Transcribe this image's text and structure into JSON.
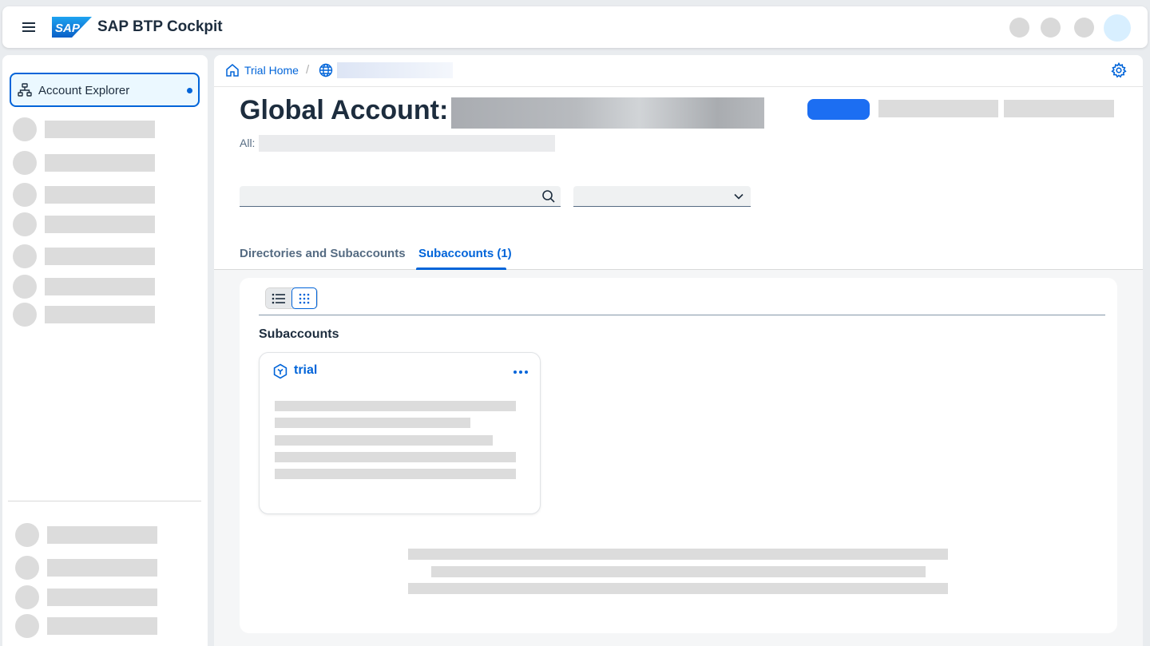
{
  "shell": {
    "app_title": "SAP BTP Cockpit",
    "logo_text": "SAP",
    "menu_icon": "hamburger-menu-icon"
  },
  "side_nav": {
    "selected_item": {
      "label": "Account Explorer",
      "icon": "hierarchy-tree-icon"
    }
  },
  "breadcrumb": {
    "home_label": "Trial Home",
    "separator": "/"
  },
  "header": {
    "title": "Global Account:",
    "sub_label": "All:"
  },
  "tabs": [
    {
      "label": "Directories and Subaccounts",
      "active": false
    },
    {
      "label": "Subaccounts (1)",
      "active": true
    }
  ],
  "content": {
    "section_title": "Subaccounts",
    "subaccount_card": {
      "name": "trial"
    }
  },
  "colors": {
    "accent": "#0064d9",
    "primary_button": "#1c6ef2",
    "skeleton": "#dcdcdc"
  }
}
